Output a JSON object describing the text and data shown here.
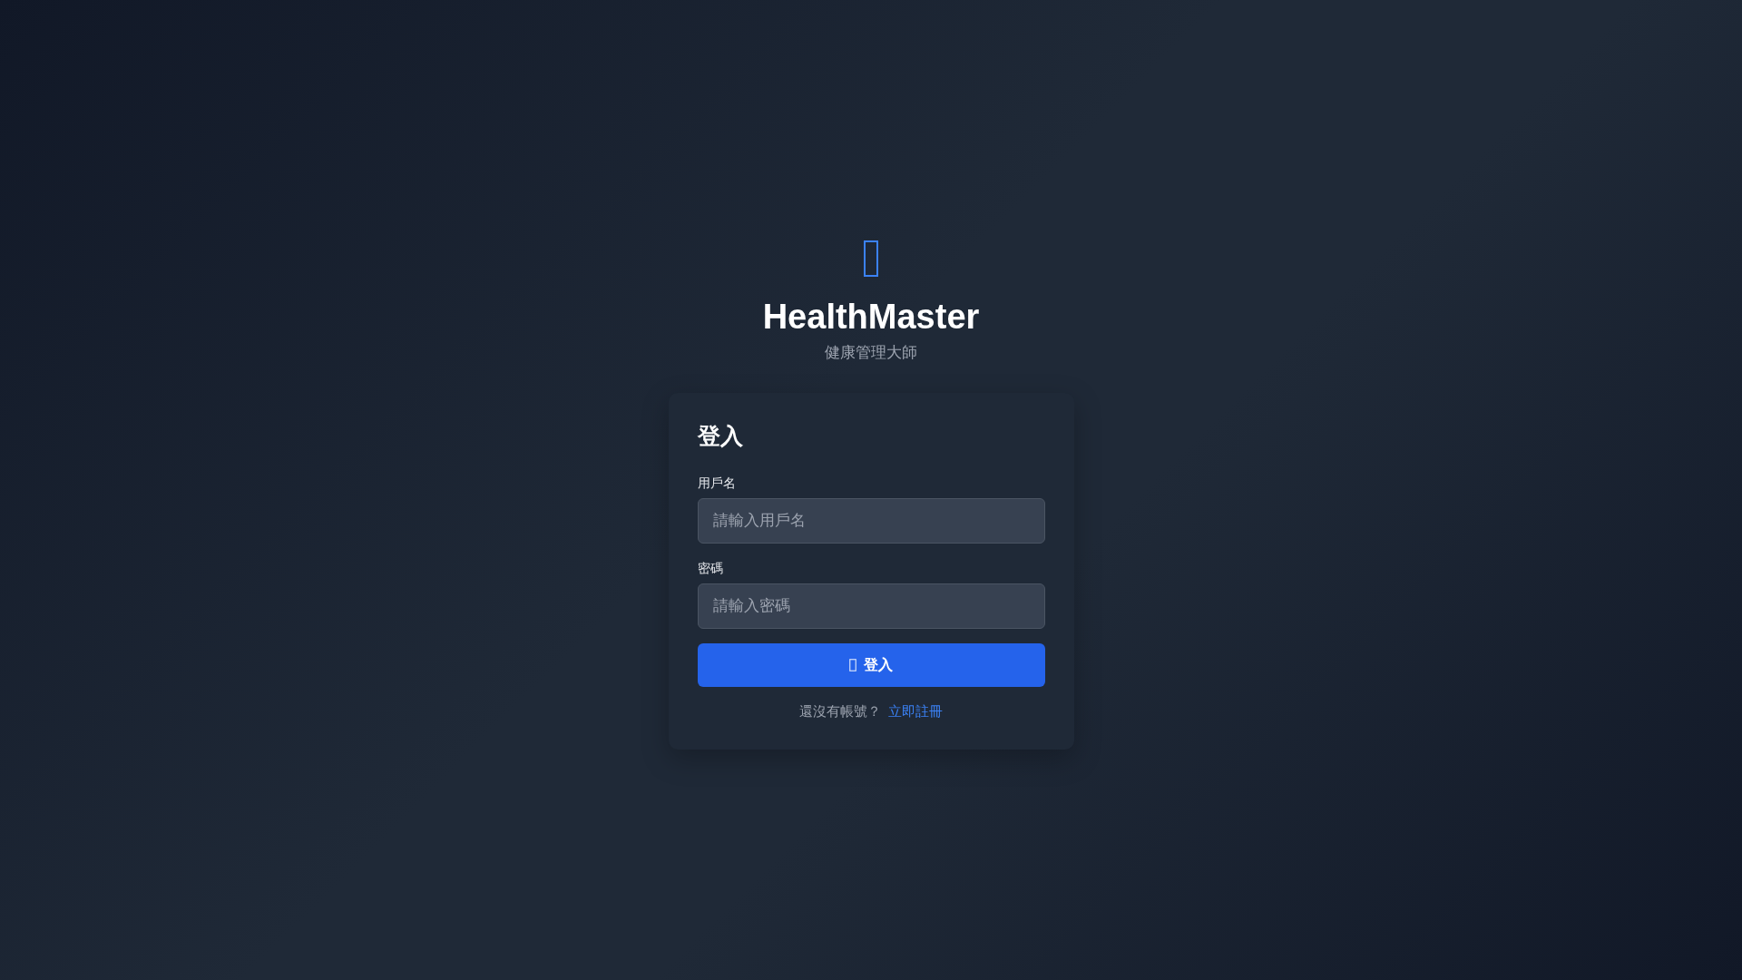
{
  "brand": {
    "title": "HealthMaster",
    "subtitle": "健康管理大師"
  },
  "card": {
    "heading": "登入",
    "fields": [
      {
        "label": "用戶名",
        "placeholder": "請輸入用戶名"
      },
      {
        "label": "密碼",
        "placeholder": "請輸入密碼"
      }
    ],
    "submit": {
      "label": "登入"
    },
    "footer": {
      "prompt": "還沒有帳號？",
      "link": "立即註冊"
    }
  }
}
